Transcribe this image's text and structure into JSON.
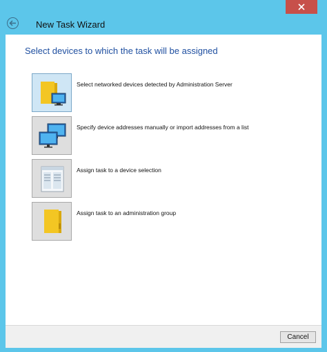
{
  "window": {
    "title": "New Task Wizard"
  },
  "main": {
    "heading": "Select devices to which the task will be assigned"
  },
  "options": [
    {
      "label": "Select networked devices detected by Administration Server",
      "icon": "folder-computer-icon",
      "selected": true
    },
    {
      "label": "Specify device addresses manually or import addresses from a list",
      "icon": "two-monitors-icon",
      "selected": false
    },
    {
      "label": "Assign task to a device selection",
      "icon": "device-selection-icon",
      "selected": false
    },
    {
      "label": "Assign task to an administration group",
      "icon": "folder-icon",
      "selected": false
    }
  ],
  "footer": {
    "cancel_label": "Cancel"
  },
  "colors": {
    "frame": "#5cc6ea",
    "heading": "#1f4fa0",
    "close": "#c7504a",
    "folder": "#f3c623"
  }
}
